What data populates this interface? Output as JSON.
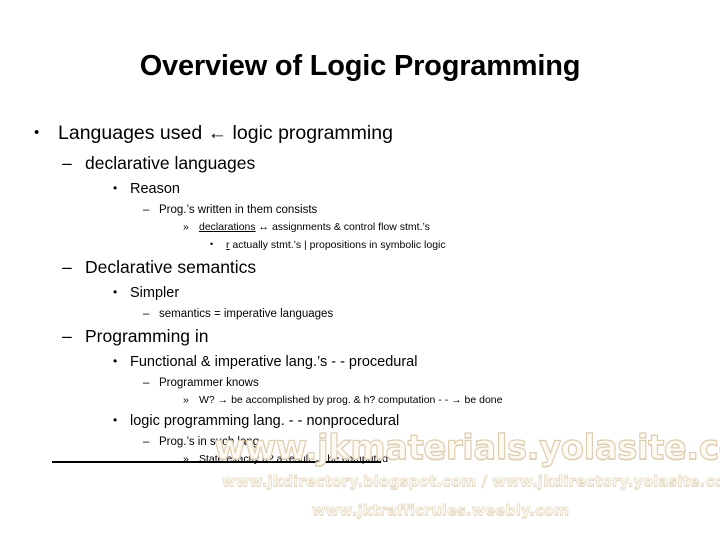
{
  "slide": {
    "title": "Overview of Logic Programming",
    "bullets": [
      {
        "level": 1,
        "marker": "•",
        "text": "Languages used ← logic programming"
      },
      {
        "level": 2,
        "marker": "–",
        "text": "declarative languages"
      },
      {
        "level": 3,
        "marker": "•",
        "text": "Reason"
      },
      {
        "level": 4,
        "marker": "–",
        "text": "Prog.’s written in them consists"
      },
      {
        "level": 5,
        "marker": "»",
        "text_underlined": "declarations",
        "text": " ↔ assignments & control flow stmt.’s"
      },
      {
        "level": 6,
        "marker": "•",
        "text_underlined": "r",
        "text": " actually stmt.’s | propositions in symbolic logic"
      },
      {
        "level": 2,
        "marker": "–",
        "text": "Declarative semantics"
      },
      {
        "level": 3,
        "marker": "•",
        "text": "Simpler"
      },
      {
        "level": 4,
        "marker": "–",
        "text": "semantics = imperative languages"
      },
      {
        "level": 2,
        "marker": "–",
        "text": "Programming in"
      },
      {
        "level": 3,
        "marker": "•",
        "text": "Functional & imperative lang.’s - - procedural"
      },
      {
        "level": 4,
        "marker": "–",
        "text": "Programmer knows"
      },
      {
        "level": 5,
        "marker": "»",
        "text": "W? → be accomplished by prog. & h? computation - - → be done"
      },
      {
        "level": 3,
        "marker": "•",
        "text": "logic programming lang. - - nonprocedural"
      },
      {
        "level": 4,
        "marker": "–",
        "text": "Prog.’s in such lang."
      },
      {
        "level": 5,
        "marker": "»",
        "text": "State exactly h? a result      → be computed"
      }
    ]
  },
  "watermarks": {
    "main": "www.jkmaterials.yolasite.com",
    "second": "www.jkdirectory.blogspot.com / www.jkdirectory.yolasite.com",
    "third": "www.jktrafficrules.weebly.com"
  },
  "colors": {
    "text": "#000000",
    "background": "#ffffff",
    "watermark_fill": "#fdfaf4",
    "watermark_outline": "#ddcdb0"
  }
}
